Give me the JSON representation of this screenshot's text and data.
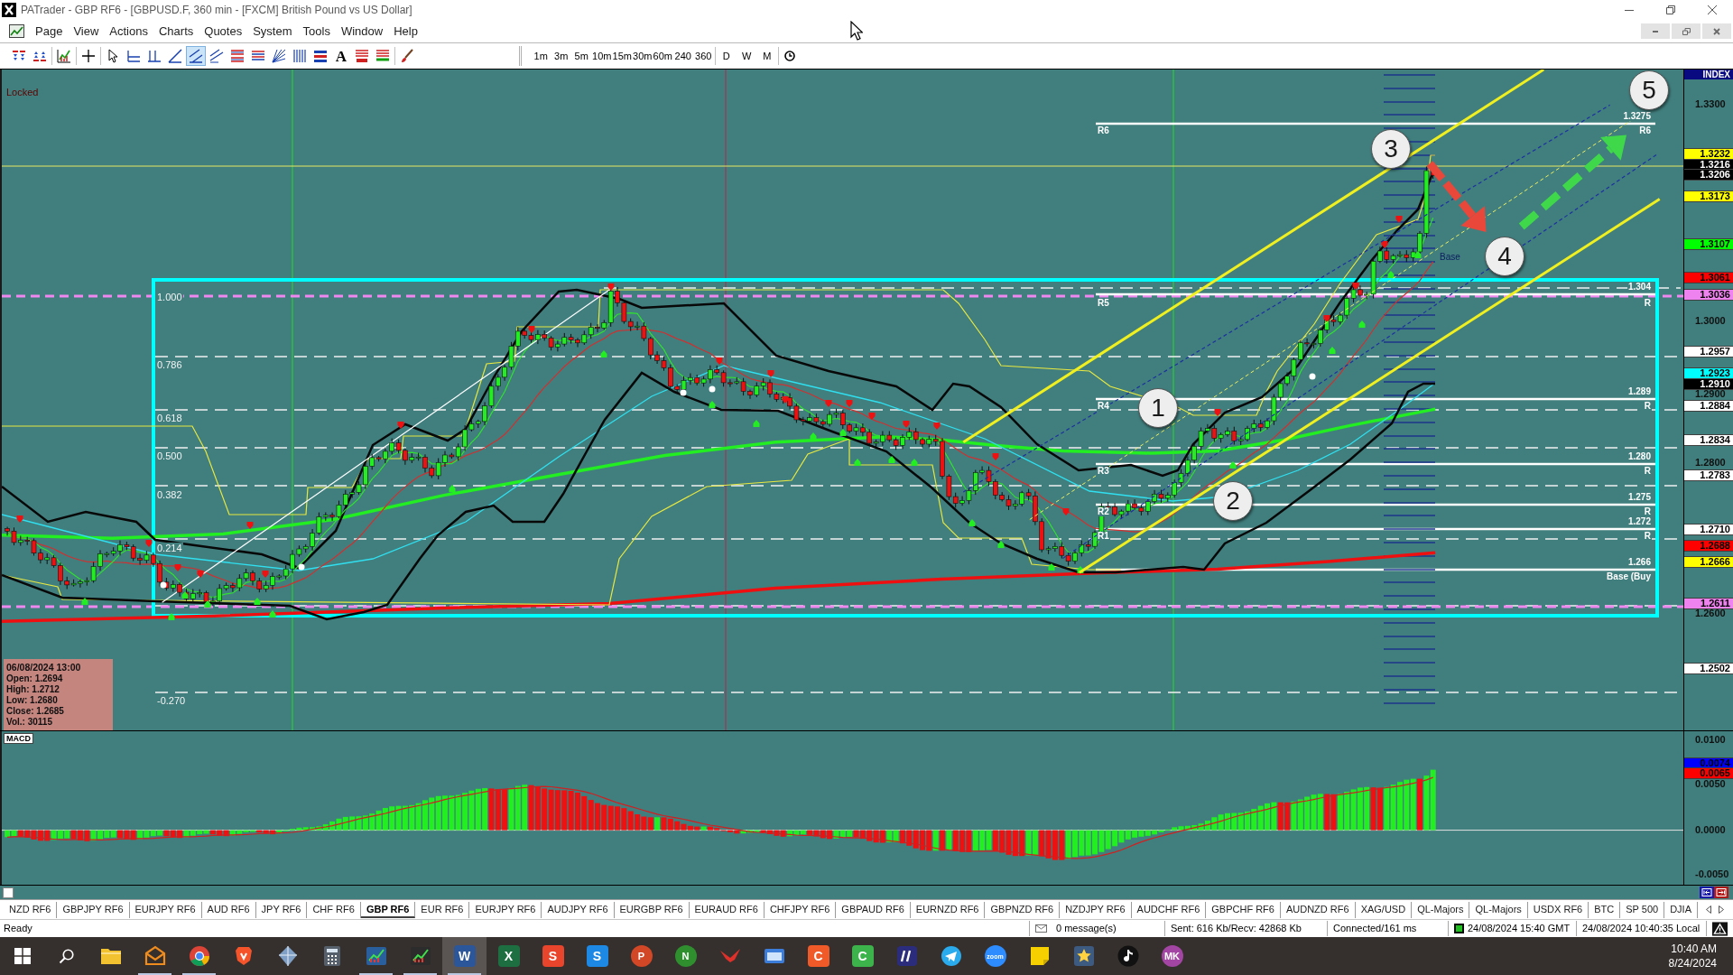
{
  "window": {
    "title": "PATrader - GBP RF6 - [GBPUSD.F, 360 min - [FXCM] British Pound vs US Dollar]"
  },
  "menu": [
    "Page",
    "View",
    "Actions",
    "Charts",
    "Quotes",
    "System",
    "Tools",
    "Window",
    "Help"
  ],
  "toolbar": {
    "tools": [
      {
        "kind": "sell",
        "selected": false
      },
      {
        "kind": "buy",
        "selected": false
      },
      {
        "kind": "indicator",
        "selected": false
      },
      {
        "kind": "crosshair",
        "selected": false
      },
      {
        "kind": "cursor",
        "selected": false
      },
      {
        "kind": "hline",
        "selected": false
      },
      {
        "kind": "vlines",
        "selected": false
      },
      {
        "kind": "trendline",
        "selected": false
      },
      {
        "kind": "channel",
        "selected": true
      },
      {
        "kind": "regression",
        "selected": false
      },
      {
        "kind": "fib",
        "selected": false
      },
      {
        "kind": "pivot",
        "selected": false
      },
      {
        "kind": "fan",
        "selected": false
      },
      {
        "kind": "cycles",
        "selected": false
      },
      {
        "kind": "bars",
        "selected": false
      },
      {
        "kind": "text",
        "label": "A",
        "selected": false
      },
      {
        "kind": "pattern",
        "selected": false
      },
      {
        "kind": "signal",
        "selected": false
      },
      {
        "kind": "brush",
        "selected": false
      }
    ],
    "timeframes": [
      "1m",
      "3m",
      "5m",
      "10m",
      "15m",
      "30m",
      "60m",
      "240",
      "360"
    ],
    "periods": [
      "D",
      "W",
      "M"
    ]
  },
  "chart": {
    "locked": "Locked",
    "fib_levels": [
      "1.000",
      "0.786",
      "0.618",
      "0.500",
      "0.382",
      "0.214",
      "-0.270"
    ],
    "pivots": [
      {
        "left": "R6",
        "value": "1.3275",
        "tag": "R6"
      },
      {
        "left": "R5",
        "value": "1.304",
        "tag": "R"
      },
      {
        "left": "R4",
        "value": "1.289",
        "tag": "R"
      },
      {
        "left": "R3",
        "value": "1.280",
        "tag": "R"
      },
      {
        "left": "R2",
        "value": "1.275",
        "tag": "R"
      },
      {
        "left": "R1",
        "value": "1.272",
        "tag": "R"
      },
      {
        "value": "1.266",
        "tag": "Base (Buy"
      }
    ],
    "base_label": "Base",
    "waves": [
      "1",
      "2",
      "3",
      "4",
      "5"
    ],
    "info": {
      "datetime": "06/08/2024 13:00",
      "lines": [
        "Open: 1.2694",
        "High: 1.2712",
        "Low: 1.2680",
        "Close: 1.2685",
        "Vol.: 30115"
      ]
    },
    "axis": {
      "header": "INDEX",
      "labels": [
        {
          "text": "1.3300",
          "kind": "tick"
        },
        {
          "text": "1.3232",
          "kind": "marker",
          "color": "#ffff00"
        },
        {
          "text": "1.3216",
          "kind": "marker",
          "color": "#000000"
        },
        {
          "text": "1.3206",
          "kind": "marker",
          "color": "#000000"
        },
        {
          "text": "1.3173",
          "kind": "marker",
          "color": "#ffff00"
        },
        {
          "text": "1.3107",
          "kind": "marker",
          "color": "#00ff00"
        },
        {
          "text": "1.3061",
          "kind": "marker",
          "color": "#ff0000"
        },
        {
          "text": "1.3036",
          "kind": "marker",
          "color": "#ee82ee"
        },
        {
          "text": "1.3000",
          "kind": "tick"
        },
        {
          "text": "1.2957",
          "kind": "marker",
          "color": "#ffffff"
        },
        {
          "text": "1.2923",
          "kind": "marker",
          "color": "#00ffff"
        },
        {
          "text": "1.2910",
          "kind": "marker",
          "color": "#000000"
        },
        {
          "text": "1.2900",
          "kind": "tick"
        },
        {
          "text": "1.2884",
          "kind": "marker",
          "color": "#ffffff"
        },
        {
          "text": "1.2834",
          "kind": "marker",
          "color": "#ffffff"
        },
        {
          "text": "1.2800",
          "kind": "tick"
        },
        {
          "text": "1.2783",
          "kind": "marker",
          "color": "#ffffff"
        },
        {
          "text": "1.2710",
          "kind": "marker",
          "color": "#ffffff"
        },
        {
          "text": "1.2688",
          "kind": "marker",
          "color": "#ff0000"
        },
        {
          "text": "1.2666",
          "kind": "marker",
          "color": "#ffff00"
        },
        {
          "text": "1.2611",
          "kind": "marker",
          "color": "#ee82ee"
        },
        {
          "text": "1.2600",
          "kind": "tick"
        },
        {
          "text": "1.2502",
          "kind": "marker",
          "color": "#ffffff"
        }
      ]
    }
  },
  "macd": {
    "title": "MACD",
    "axis": [
      {
        "text": "0.0100",
        "kind": "tick"
      },
      {
        "text": "0.0074",
        "kind": "marker",
        "color": "#0000ff"
      },
      {
        "text": "0.0065",
        "kind": "marker",
        "color": "#ff0000"
      },
      {
        "text": "0.0050",
        "kind": "tick"
      },
      {
        "text": "0.0000",
        "kind": "tick"
      },
      {
        "text": "-0.0050",
        "kind": "tick"
      }
    ]
  },
  "tabs": [
    {
      "label": "NZD RF6",
      "selected": false
    },
    {
      "label": "GBPJPY RF6",
      "selected": false
    },
    {
      "label": "EURJPY RF6",
      "selected": false
    },
    {
      "label": "AUD RF6",
      "selected": false
    },
    {
      "label": "JPY RF6",
      "selected": false
    },
    {
      "label": "CHF RF6",
      "selected": false
    },
    {
      "label": "GBP RF6",
      "selected": true
    },
    {
      "label": "EUR RF6",
      "selected": false
    },
    {
      "label": "EURJPY RF6",
      "selected": false
    },
    {
      "label": "AUDJPY RF6",
      "selected": false
    },
    {
      "label": "EURGBP RF6",
      "selected": false
    },
    {
      "label": "EURAUD RF6",
      "selected": false
    },
    {
      "label": "CHFJPY RF6",
      "selected": false
    },
    {
      "label": "GBPAUD RF6",
      "selected": false
    },
    {
      "label": "EURNZD RF6",
      "selected": false
    },
    {
      "label": "GBPNZD RF6",
      "selected": false
    },
    {
      "label": "NZDJPY RF6",
      "selected": false
    },
    {
      "label": "AUDCHF RF6",
      "selected": false
    },
    {
      "label": "GBPCHF RF6",
      "selected": false
    },
    {
      "label": "AUDNZD RF6",
      "selected": false
    },
    {
      "label": "XAG/USD",
      "selected": false
    },
    {
      "label": "QL-Majors",
      "selected": false
    },
    {
      "label": "QL-Majors",
      "selected": false
    },
    {
      "label": "USDX RF6",
      "selected": false
    },
    {
      "label": "BTC",
      "selected": false
    },
    {
      "label": "SP 500",
      "selected": false
    },
    {
      "label": "DJIA",
      "selected": false
    }
  ],
  "status_bar": {
    "text": "Ready",
    "messages": "0 message(s)",
    "traffic": "Sent: 616 Kb/Recv: 42868 Kb",
    "connection": "Connected/161 ms",
    "server_time": "24/08/2024 15:40 GMT",
    "local_time": "24/08/2024 10:40:35 Local"
  },
  "taskbar": {
    "apps": [
      {
        "kind": "windows",
        "running": false,
        "active": false
      },
      {
        "kind": "search",
        "running": false,
        "active": false
      },
      {
        "kind": "folder",
        "color": "#f2c230",
        "running": false,
        "active": false
      },
      {
        "kind": "mail",
        "color": "#f08c1e",
        "running": true,
        "active": false
      },
      {
        "kind": "chrome",
        "running": true,
        "active": false
      },
      {
        "kind": "shield",
        "color": "#f5542b",
        "running": false,
        "active": false
      },
      {
        "kind": "gem",
        "color": "#7f9fc4",
        "running": false,
        "active": false
      },
      {
        "kind": "calculator",
        "color": "#55606c",
        "running": false,
        "active": false
      },
      {
        "kind": "chart",
        "color": "#2a5f9e",
        "running": true,
        "active": false
      },
      {
        "kind": "chart",
        "color": "#2c2c2c",
        "running": true,
        "active": false
      },
      {
        "kind": "tile",
        "label": "W",
        "color": "#2b579a",
        "running": true,
        "active": true
      },
      {
        "kind": "tile",
        "label": "X",
        "color": "#1d6f42",
        "running": false,
        "active": false
      },
      {
        "kind": "tile",
        "label": "S",
        "color": "#e8452c",
        "running": false,
        "active": false
      },
      {
        "kind": "tile",
        "label": "S",
        "color": "#1e88e5",
        "running": false,
        "active": false
      },
      {
        "kind": "circle",
        "label": "P",
        "color": "#d24726",
        "running": false,
        "active": false
      },
      {
        "kind": "circle",
        "label": "N",
        "color": "#2f8f2f",
        "running": false,
        "active": false
      },
      {
        "kind": "bird",
        "color": "#e0302a",
        "running": false,
        "active": false
      },
      {
        "kind": "window",
        "color": "#3b7dd8",
        "running": false,
        "active": false
      },
      {
        "kind": "tile",
        "label": "C",
        "color": "#f05a28",
        "running": false,
        "active": false
      },
      {
        "kind": "tile",
        "label": "C",
        "color": "#3cb44b",
        "running": false,
        "active": false
      },
      {
        "kind": "slashes",
        "color": "#2b2d7c",
        "running": false,
        "active": false
      },
      {
        "kind": "plane",
        "color": "#2aabee",
        "running": false,
        "active": false
      },
      {
        "kind": "circle",
        "label": "zoom",
        "color": "#2d8cff",
        "running": false,
        "active": false
      },
      {
        "kind": "sticky",
        "color": "#f7d000",
        "running": false,
        "active": false
      },
      {
        "kind": "star",
        "color": "#3d5a80",
        "running": false,
        "active": false
      },
      {
        "kind": "note",
        "color": "#111111",
        "running": false,
        "active": false
      },
      {
        "kind": "circle",
        "label": "MK",
        "color": "#a346a3",
        "running": false,
        "active": false
      }
    ],
    "time": "10:40 AM",
    "date": "8/24/2024"
  }
}
